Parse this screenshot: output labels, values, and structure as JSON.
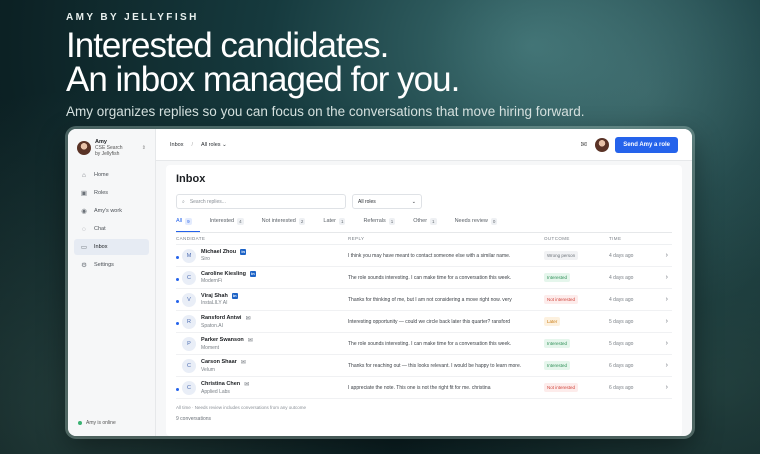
{
  "hero": {
    "brand": "AMY BY JELLYFISH",
    "headline_1": "Interested candidates.",
    "headline_2": "An inbox managed for you.",
    "subhead": "Amy organizes replies so you can focus on the conversations that move hiring forward."
  },
  "sidebar": {
    "account_name": "Amy",
    "account_sub1": "CSE Search",
    "account_sub2": "by Jellyfish",
    "items": [
      {
        "label": "Home",
        "icon": "home-icon"
      },
      {
        "label": "Roles",
        "icon": "briefcase-icon"
      },
      {
        "label": "Amy's work",
        "icon": "user-icon"
      },
      {
        "label": "Chat",
        "icon": "chat-icon"
      },
      {
        "label": "Inbox",
        "icon": "inbox-icon",
        "active": true
      },
      {
        "label": "Settings",
        "icon": "gear-icon"
      }
    ],
    "status": "Amy is online"
  },
  "topbar": {
    "breadcrumb_1": "Inbox",
    "breadcrumb_sep": "/",
    "breadcrumb_2": "All roles",
    "cta": "Send Amy a role"
  },
  "inbox": {
    "title": "Inbox",
    "search_placeholder": "Search replies...",
    "roles_filter": "All roles",
    "tabs": [
      {
        "label": "All",
        "count": "9",
        "active": true
      },
      {
        "label": "Interested",
        "count": "4"
      },
      {
        "label": "Not interested",
        "count": "2"
      },
      {
        "label": "Later",
        "count": "1"
      },
      {
        "label": "Referrals",
        "count": "1"
      },
      {
        "label": "Other",
        "count": "1"
      },
      {
        "label": "Needs review",
        "count": "0"
      }
    ],
    "columns": {
      "candidate": "CANDIDATE",
      "reply": "REPLY",
      "outcome": "OUTCOME",
      "time": "TIME"
    },
    "rows": [
      {
        "initial": "M",
        "name": "Michael Zhou",
        "company": "Siro",
        "channel": "linkedin",
        "unread": true,
        "reply": "I think you may have meant to contact someone else with a similar name.",
        "outcome": "Wrong person",
        "outcome_class": "b-wrong",
        "time": "4 days ago"
      },
      {
        "initial": "C",
        "name": "Caroline Kiesling",
        "company": "ModernFi",
        "channel": "linkedin",
        "unread": true,
        "reply": "The role sounds interesting. I can make time for a conversation this week.",
        "outcome": "Interested",
        "outcome_class": "b-int",
        "time": "4 days ago"
      },
      {
        "initial": "V",
        "name": "Viraj Shah",
        "company": "InstaLILY AI",
        "channel": "linkedin",
        "unread": true,
        "reply": "Thanks for thinking of me, but I am not considering a move right now. very",
        "outcome": "Not interested",
        "outcome_class": "b-not",
        "time": "4 days ago"
      },
      {
        "initial": "R",
        "name": "Ransford Antwi",
        "company": "Spaton.AI",
        "channel": "email",
        "unread": true,
        "reply": "Interesting opportunity — could we circle back later this quarter? ransford",
        "outcome": "Later",
        "outcome_class": "b-later",
        "time": "5 days ago"
      },
      {
        "initial": "P",
        "name": "Parker Swanson",
        "company": "Moment",
        "channel": "email",
        "unread": false,
        "reply": "The role sounds interesting. I can make time for a conversation this week.",
        "outcome": "Interested",
        "outcome_class": "b-int",
        "time": "5 days ago"
      },
      {
        "initial": "C",
        "name": "Carson Shaar",
        "company": "Velum",
        "channel": "email",
        "unread": false,
        "reply": "Thanks for reaching out — this looks relevant. I would be happy to learn more.",
        "outcome": "Interested",
        "outcome_class": "b-int",
        "time": "6 days ago"
      },
      {
        "initial": "C",
        "name": "Christina Chen",
        "company": "Applied Labs",
        "channel": "email",
        "unread": true,
        "reply": "I appreciate the note. This one is not the right fit for me. christina",
        "outcome": "Not interested",
        "outcome_class": "b-not",
        "time": "6 days ago"
      }
    ],
    "footnote": "All time · Needs review includes conversations from any outcome",
    "conversation_count": "9 conversations"
  }
}
